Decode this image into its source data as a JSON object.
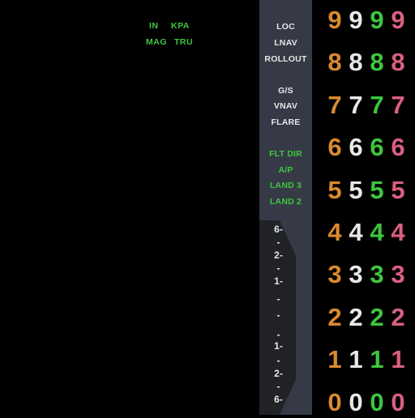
{
  "units": {
    "row1": [
      "IN",
      "KPA"
    ],
    "row2": [
      "MAG",
      "TRU"
    ]
  },
  "annunciators": {
    "group1": [
      "LOC",
      "LNAV",
      "ROLLOUT"
    ],
    "group2": [
      "G/S",
      "VNAV",
      "FLARE"
    ],
    "group3": [
      "FLT DIR",
      "A/P",
      "LAND 3",
      "LAND 2"
    ]
  },
  "vs_scale": [
    "6-",
    "-",
    "2-",
    "-",
    "1-",
    "-",
    "-",
    "-",
    "1-",
    "-",
    "2-",
    "-",
    "6-"
  ],
  "digit_rows": [
    "9",
    "8",
    "7",
    "6",
    "5",
    "4",
    "3",
    "2",
    "1",
    "0"
  ],
  "digit_colors": [
    "#d98a2f",
    "#e8e8e8",
    "#3ec63e",
    "#d9607f"
  ],
  "colors": {
    "background": "#000000",
    "panel": "#363a46",
    "green_text": "#3ec63e",
    "white_text": "#e6e6e6"
  }
}
